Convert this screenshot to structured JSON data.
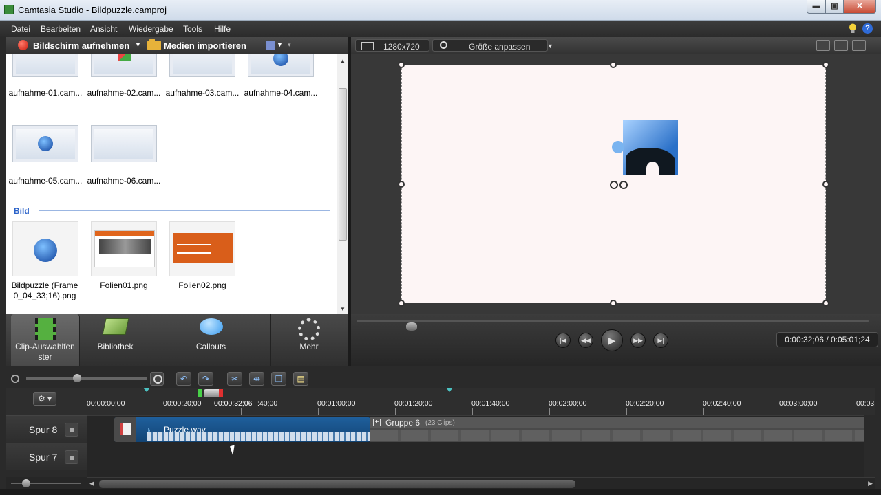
{
  "window": {
    "title": "Camtasia Studio - Bildpuzzle.camproj",
    "minimize": "▬",
    "maximize": "▣",
    "close": "✕"
  },
  "menu": [
    "Datei",
    "Bearbeiten",
    "Ansicht",
    "Wiedergabe",
    "Tools",
    "Hilfe"
  ],
  "help_icon_label": "?",
  "left_toolbar": {
    "record_label": "Bildschirm aufnehmen",
    "import_label": "Medien importieren"
  },
  "clip_bin": {
    "recordings": [
      {
        "label": "aufnahme-01.cam..."
      },
      {
        "label": "aufnahme-02.cam..."
      },
      {
        "label": "aufnahme-03.cam..."
      },
      {
        "label": "aufnahme-04.cam..."
      },
      {
        "label": "aufnahme-05.cam..."
      },
      {
        "label": "aufnahme-06.cam..."
      }
    ],
    "image_section": "Bild",
    "images": [
      {
        "label": "Bildpuzzle (Frame 0_04_33;16).png"
      },
      {
        "label": "Folien01.png"
      },
      {
        "label": "Folien02.png"
      }
    ]
  },
  "task_tabs": [
    {
      "label": "Clip-Auswahlfenster",
      "active": true
    },
    {
      "label": "Bibliothek",
      "active": false
    },
    {
      "label": "Callouts",
      "active": false
    },
    {
      "label": "Mehr",
      "active": false
    }
  ],
  "preview_toolbar": {
    "dimensions": "1280x720",
    "zoom": "Größe anpassen"
  },
  "player": {
    "timecode": "0:00:32;06 / 0:05:01;24",
    "seek_position": 0.107
  },
  "timeline": {
    "ticks": [
      "00:00:00;00",
      "00:00:20;00",
      ":40;00",
      "00:01:00;00",
      "00:01:20;00",
      "00:01:40;00",
      "00:02:00;00",
      "00:02:20;00",
      "00:02:40;00",
      "00:03:00;00",
      "00:03:"
    ],
    "playhead_label": "00:00:32;06",
    "tracks": [
      {
        "name": "Spur 8"
      },
      {
        "name": "Spur 7"
      }
    ],
    "audio_clip": "Puzzle.wav",
    "group_name": "Gruppe 6",
    "group_count": "(23 Clips)"
  },
  "icons": {
    "record": "record-icon",
    "import": "folder-icon",
    "gear": "⚙",
    "note": "♪",
    "play": "▶",
    "pause_prev": "|◀",
    "rewind": "◀◀",
    "forward": "▶▶",
    "next": "▶|"
  }
}
